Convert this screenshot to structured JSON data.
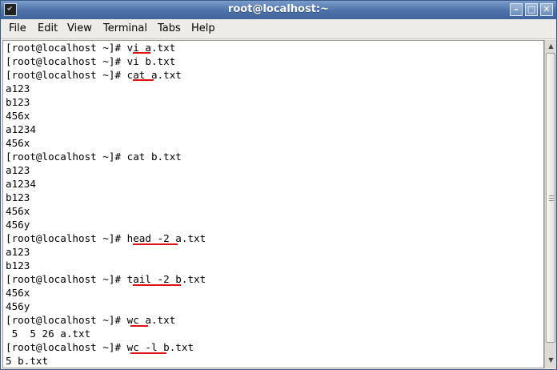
{
  "window": {
    "title": "root@localhost:~",
    "buttons": {
      "minimize": "–",
      "maximize": "□",
      "close": "✕"
    }
  },
  "menubar": {
    "items": [
      "File",
      "Edit",
      "View",
      "Terminal",
      "Tabs",
      "Help"
    ]
  },
  "terminal": {
    "lines": [
      "[root@localhost ~]# vi a.txt",
      "[root@localhost ~]# vi b.txt",
      "[root@localhost ~]# cat a.txt",
      "a123",
      "b123",
      "456x",
      "a1234",
      "456x",
      "[root@localhost ~]# cat b.txt",
      "a123",
      "a1234",
      "b123",
      "456x",
      "456y",
      "[root@localhost ~]# head -2 a.txt",
      "a123",
      "b123",
      "[root@localhost ~]# tail -2 b.txt",
      "456x",
      "456y",
      "[root@localhost ~]# wc a.txt",
      " 5  5 26 a.txt",
      "[root@localhost ~]# wc -l b.txt",
      "5 b.txt"
    ]
  },
  "annotations": {
    "underline_color": "#dd1111"
  }
}
